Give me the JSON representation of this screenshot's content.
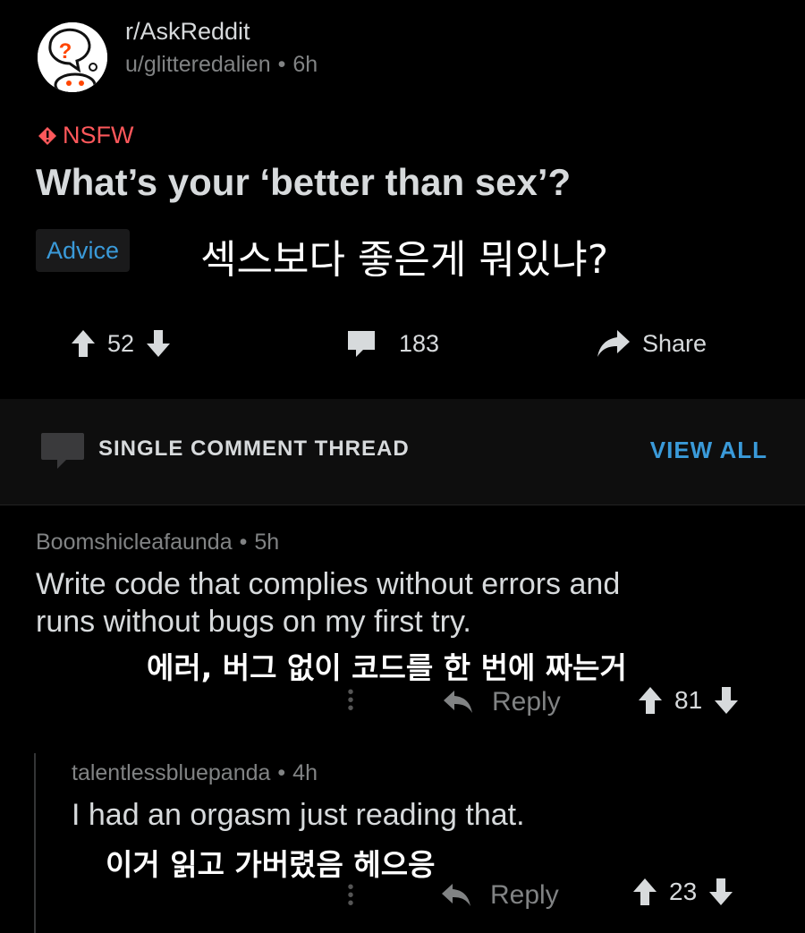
{
  "post": {
    "subreddit": "r/AskReddit",
    "author": "u/glitteredalien",
    "age": "6h",
    "nsfw_label": "NSFW",
    "title": "What’s your ‘better than sex’?",
    "flair": "Advice",
    "title_kr": "섹스보다 좋은게 뭐있냐?",
    "upvotes": "52",
    "comments": "183",
    "share_label": "Share"
  },
  "thread": {
    "label": "SINGLE COMMENT THREAD",
    "view_all": "VIEW ALL"
  },
  "comments": [
    {
      "user": "Boomshicleafaunda",
      "age": "5h",
      "line1": "Write code that complies without errors and",
      "line2": "runs without bugs on my first try.",
      "kr": "에러, 버그 없이 코드를 한 번에 짜는거",
      "reply_label": "Reply",
      "score": "81"
    },
    {
      "user": "talentlessbluepanda",
      "age": "4h",
      "line1": "I had an orgasm just reading that.",
      "kr": "이거 읽고 가버렸음 헤으응",
      "reply_label": "Reply",
      "score": "23"
    }
  ],
  "icons": [
    "subreddit-avatar-icon",
    "nsfw-warning-icon",
    "upvote-icon",
    "downvote-icon",
    "comment-icon",
    "share-icon",
    "thread-comment-icon",
    "more-options-icon",
    "reply-icon"
  ],
  "colors": {
    "background": "#000000",
    "text": "#d7dadc",
    "muted": "#818384",
    "nsfw": "#ff585b",
    "link": "#3a9ad9"
  }
}
